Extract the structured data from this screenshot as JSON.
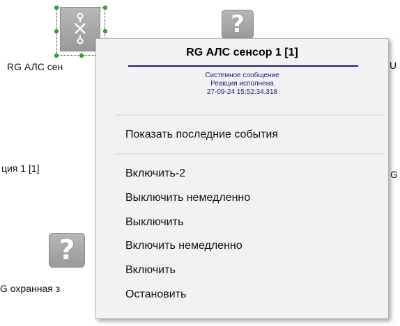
{
  "devices": [
    {
      "label": "RG АЛС сен",
      "icon": "sensor-x-icon"
    },
    {
      "label": "?",
      "icon": "question-icon"
    },
    {
      "label": "ция 1 [1]"
    },
    {
      "label": "U"
    },
    {
      "label": "G"
    },
    {
      "label": "?",
      "icon": "question-icon"
    },
    {
      "label": "G охранная з"
    }
  ],
  "menu": {
    "title": "RG АЛС сенсор 1 [1]",
    "status": [
      "Системное сообщение",
      "Реакция исполнена",
      "27-09-24 15:52:34.318"
    ],
    "show_events": "Показать последние события",
    "items": [
      "Включить-2",
      "Выключить немедленно",
      "Выключить",
      "Включить немедленно",
      "Включить",
      "Остановить"
    ]
  },
  "colors": {
    "title_underline": "#1c1c7a",
    "status_text": "#1a1a8c",
    "selection_handle": "#22bb22"
  }
}
